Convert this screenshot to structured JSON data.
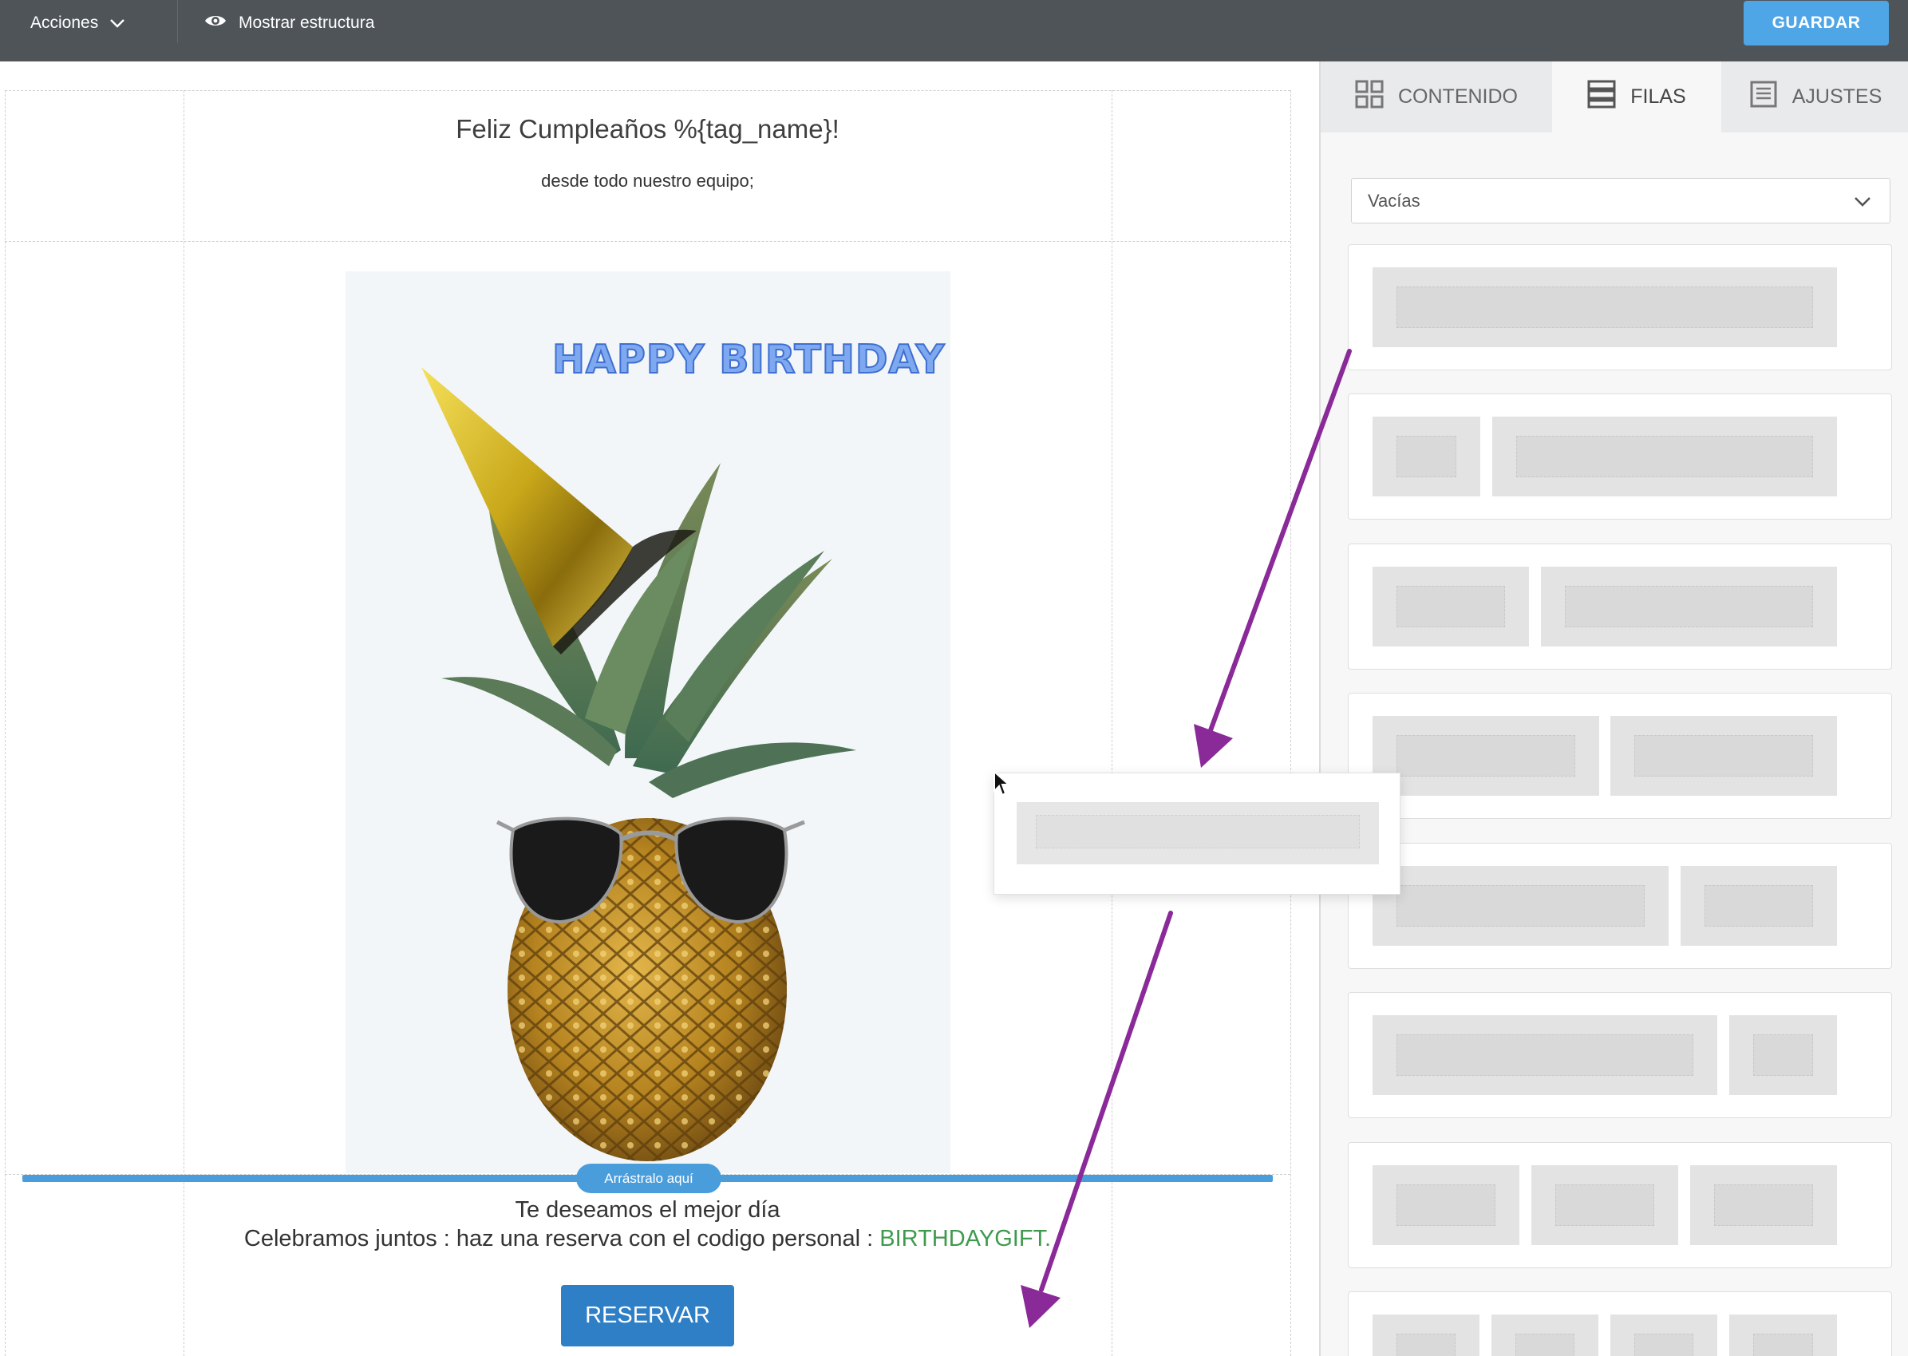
{
  "topbar": {
    "actions_label": "Acciones",
    "show_structure_label": "Mostrar estructura",
    "save_label": "GUARDAR"
  },
  "email": {
    "title": "Feliz Cumpleaños %{tag_name}!",
    "subtitle": "desde todo nuestro equipo;",
    "image_headline": "HAPPY BIRTHDAY",
    "drop_label": "Arrástralo aquí",
    "wish_line": "Te deseamos el mejor día",
    "reserve_line_prefix": "Celebramos juntos : haz una reserva con el codigo personal : ",
    "promo_code": "BIRTHDAYGIFT.",
    "reserve_button": "RESERVAR"
  },
  "sidebar": {
    "tabs": [
      {
        "label": "CONTENIDO",
        "icon": "grid-icon",
        "active": false
      },
      {
        "label": "FILAS",
        "icon": "rows-icon",
        "active": true
      },
      {
        "label": "AJUSTES",
        "icon": "settings-doc-icon",
        "active": false
      }
    ],
    "row_filter": {
      "selected": "Vacías"
    },
    "row_layouts": [
      {
        "name": "1 columna"
      },
      {
        "name": "1-3"
      },
      {
        "name": "1-2"
      },
      {
        "name": "2 columnas"
      },
      {
        "name": "2-1"
      },
      {
        "name": "3-1"
      },
      {
        "name": "3 columnas"
      },
      {
        "name": "4 columnas"
      }
    ]
  },
  "colors": {
    "topbar": "#4f5459",
    "save_button": "#4fa6e6",
    "drop_line": "#4a9ddb",
    "reserve_button": "#2f7fc7",
    "promo_code": "#3f9a4e",
    "arrow": "#8a2a98"
  }
}
